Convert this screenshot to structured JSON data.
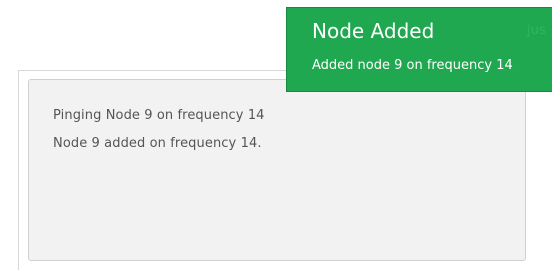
{
  "log": {
    "lines": [
      "Pinging Node 9 on frequency 14",
      "Node 9 added on frequency 14."
    ]
  },
  "toast": {
    "title": "Node Added",
    "time": "jus",
    "message": "Added node 9 on frequency 14",
    "color": "#1fa84f"
  }
}
